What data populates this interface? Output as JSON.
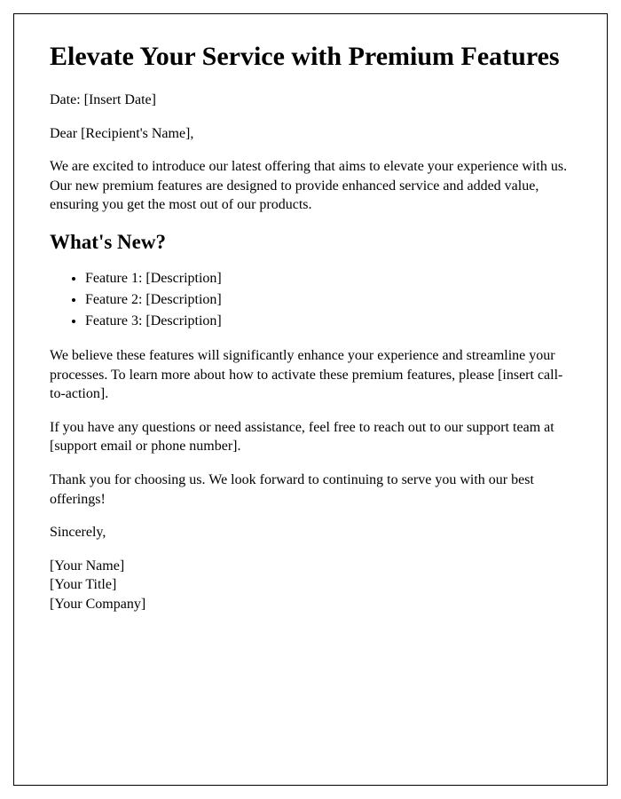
{
  "title": "Elevate Your Service with Premium Features",
  "date_line": "Date: [Insert Date]",
  "salutation": "Dear [Recipient's Name],",
  "intro_paragraph": "We are excited to introduce our latest offering that aims to elevate your experience with us. Our new premium features are designed to provide enhanced service and added value, ensuring you get the most out of our products.",
  "section_heading": "What's New?",
  "features": [
    "Feature 1: [Description]",
    "Feature 2: [Description]",
    "Feature 3: [Description]"
  ],
  "body_paragraph_1": "We believe these features will significantly enhance your experience and streamline your processes. To learn more about how to activate these premium features, please [insert call-to-action].",
  "body_paragraph_2": "If you have any questions or need assistance, feel free to reach out to our support team at [support email or phone number].",
  "body_paragraph_3": "Thank you for choosing us. We look forward to continuing to serve you with our best offerings!",
  "closing": "Sincerely,",
  "signature": {
    "name": "[Your Name]",
    "title": "[Your Title]",
    "company": "[Your Company]"
  }
}
